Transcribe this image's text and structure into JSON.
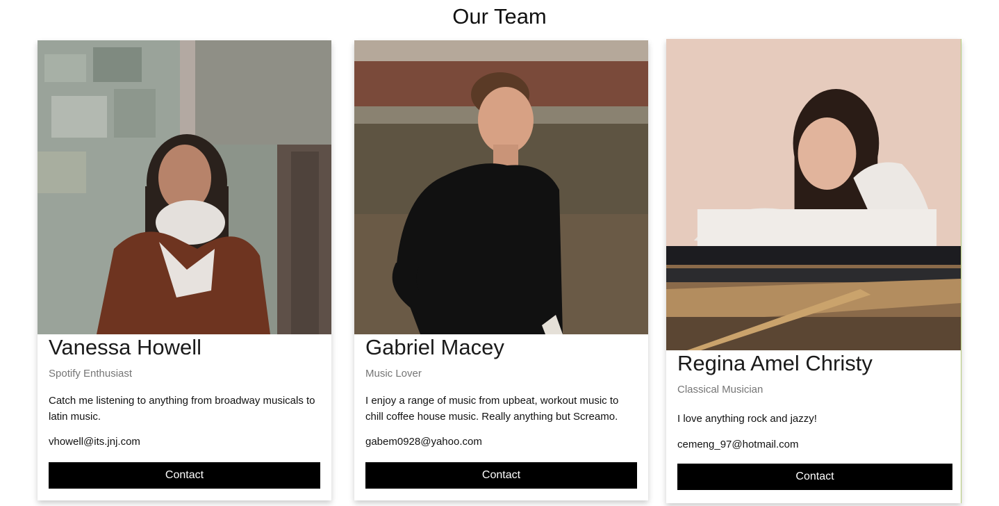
{
  "page": {
    "title": "Our Team"
  },
  "members": [
    {
      "name": "Vanessa Howell",
      "title": "Spotify Enthusiast",
      "bio": "Catch me listening to anything from broadway musicals to latin music.",
      "email": "vhowell@its.jnj.com",
      "button_label": "Contact"
    },
    {
      "name": "Gabriel Macey",
      "title": "Music Lover",
      "bio": "I enjoy a range of music from upbeat, workout music to chill coffee house music. Really anything but Screamo.",
      "email": "gabem0928@yahoo.com",
      "button_label": "Contact"
    },
    {
      "name": "Regina Amel Christy",
      "title": "Classical Musician",
      "bio": "I love anything rock and jazzy!",
      "email": "cemeng_97@hotmail.com",
      "button_label": "Contact"
    }
  ],
  "colors": {
    "button_bg": "#000000",
    "button_text": "#ffffff",
    "subtitle_text": "#757575"
  }
}
